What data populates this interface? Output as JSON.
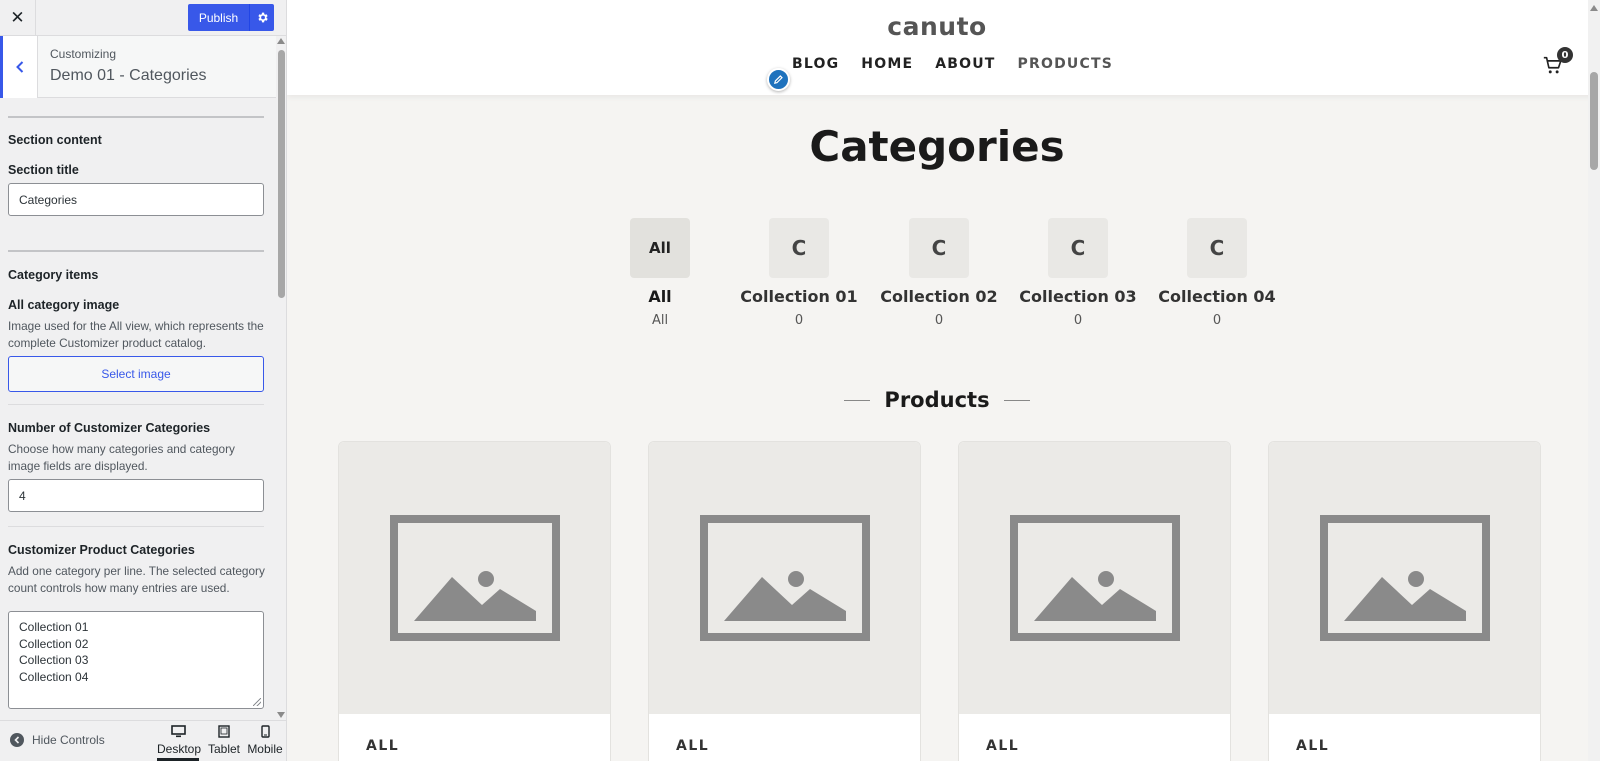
{
  "sidebar": {
    "publish_label": "Publish",
    "customizing_label": "Customizing",
    "panel_title": "Demo 01 - Categories",
    "section_content_heading": "Section content",
    "section_title_label": "Section title",
    "section_title_value": "Categories",
    "category_items_heading": "Category items",
    "all_image_label": "All category image",
    "all_image_desc": "Image used for the All view, which represents the complete Customizer product catalog.",
    "select_image_label": "Select image",
    "num_categories_label": "Number of Customizer Categories",
    "num_categories_desc": "Choose how many categories and category image fields are displayed.",
    "num_categories_value": "4",
    "product_categories_label": "Customizer Product Categories",
    "product_categories_desc": "Add one category per line. The selected category count controls how many entries are used.",
    "product_categories_lines": [
      "Collection 01",
      "Collection 02",
      "Collection 03",
      "Collection 04"
    ],
    "hide_controls_label": "Hide Controls",
    "devices": [
      "Desktop",
      "Tablet",
      "Mobile"
    ]
  },
  "site": {
    "logo": "canuto",
    "nav": [
      "BLOG",
      "HOME",
      "ABOUT",
      "PRODUCTS"
    ],
    "cart_count": "0",
    "categories_heading": "Categories",
    "categories": [
      {
        "tile": "All",
        "name": "All",
        "count": "All"
      },
      {
        "tile": "C",
        "name": "Collection 01",
        "count": "0"
      },
      {
        "tile": "C",
        "name": "Collection 02",
        "count": "0"
      },
      {
        "tile": "C",
        "name": "Collection 03",
        "count": "0"
      },
      {
        "tile": "C",
        "name": "Collection 04",
        "count": "0"
      }
    ],
    "products_heading": "Products",
    "product_cards": [
      {
        "label": "ALL"
      },
      {
        "label": "ALL"
      },
      {
        "label": "ALL"
      },
      {
        "label": "ALL"
      }
    ]
  },
  "colors": {
    "accent": "#3858e9",
    "edit_pencil": "#1e72bd",
    "preview_bg": "#f5f4f2",
    "placeholder_gray": "#8a8a8a"
  },
  "icons": [
    "close-icon",
    "gear-icon",
    "chevron-left-icon",
    "pencil-icon",
    "cart-icon",
    "image-placeholder-icon",
    "desktop-icon",
    "tablet-icon",
    "mobile-icon",
    "arrow-left-circle-icon"
  ]
}
